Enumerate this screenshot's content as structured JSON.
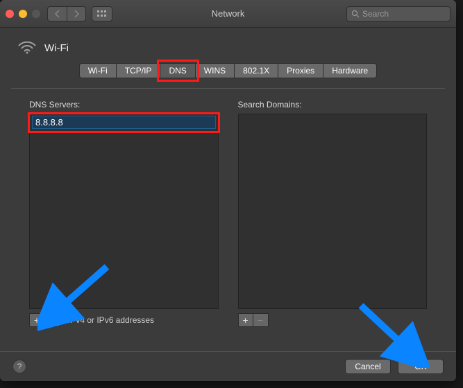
{
  "window": {
    "title": "Network"
  },
  "search": {
    "placeholder": "Search"
  },
  "header": {
    "interface": "Wi-Fi"
  },
  "tabs": [
    {
      "label": "Wi-Fi",
      "active": false
    },
    {
      "label": "TCP/IP",
      "active": false
    },
    {
      "label": "DNS",
      "active": true,
      "highlighted": true
    },
    {
      "label": "WINS",
      "active": false
    },
    {
      "label": "802.1X",
      "active": false
    },
    {
      "label": "Proxies",
      "active": false
    },
    {
      "label": "Hardware",
      "active": false
    }
  ],
  "dns": {
    "label": "DNS Servers:",
    "entries": [
      "8.8.8.8"
    ],
    "footer_hint": "IPv4 or IPv6 addresses",
    "minus_enabled": true
  },
  "search_domains": {
    "label": "Search Domains:",
    "entries": [],
    "minus_enabled": false
  },
  "buttons": {
    "cancel": "Cancel",
    "ok": "OK"
  },
  "annotations": {
    "highlight_color": "#ff1a1a",
    "arrow_color": "#0a84ff"
  }
}
